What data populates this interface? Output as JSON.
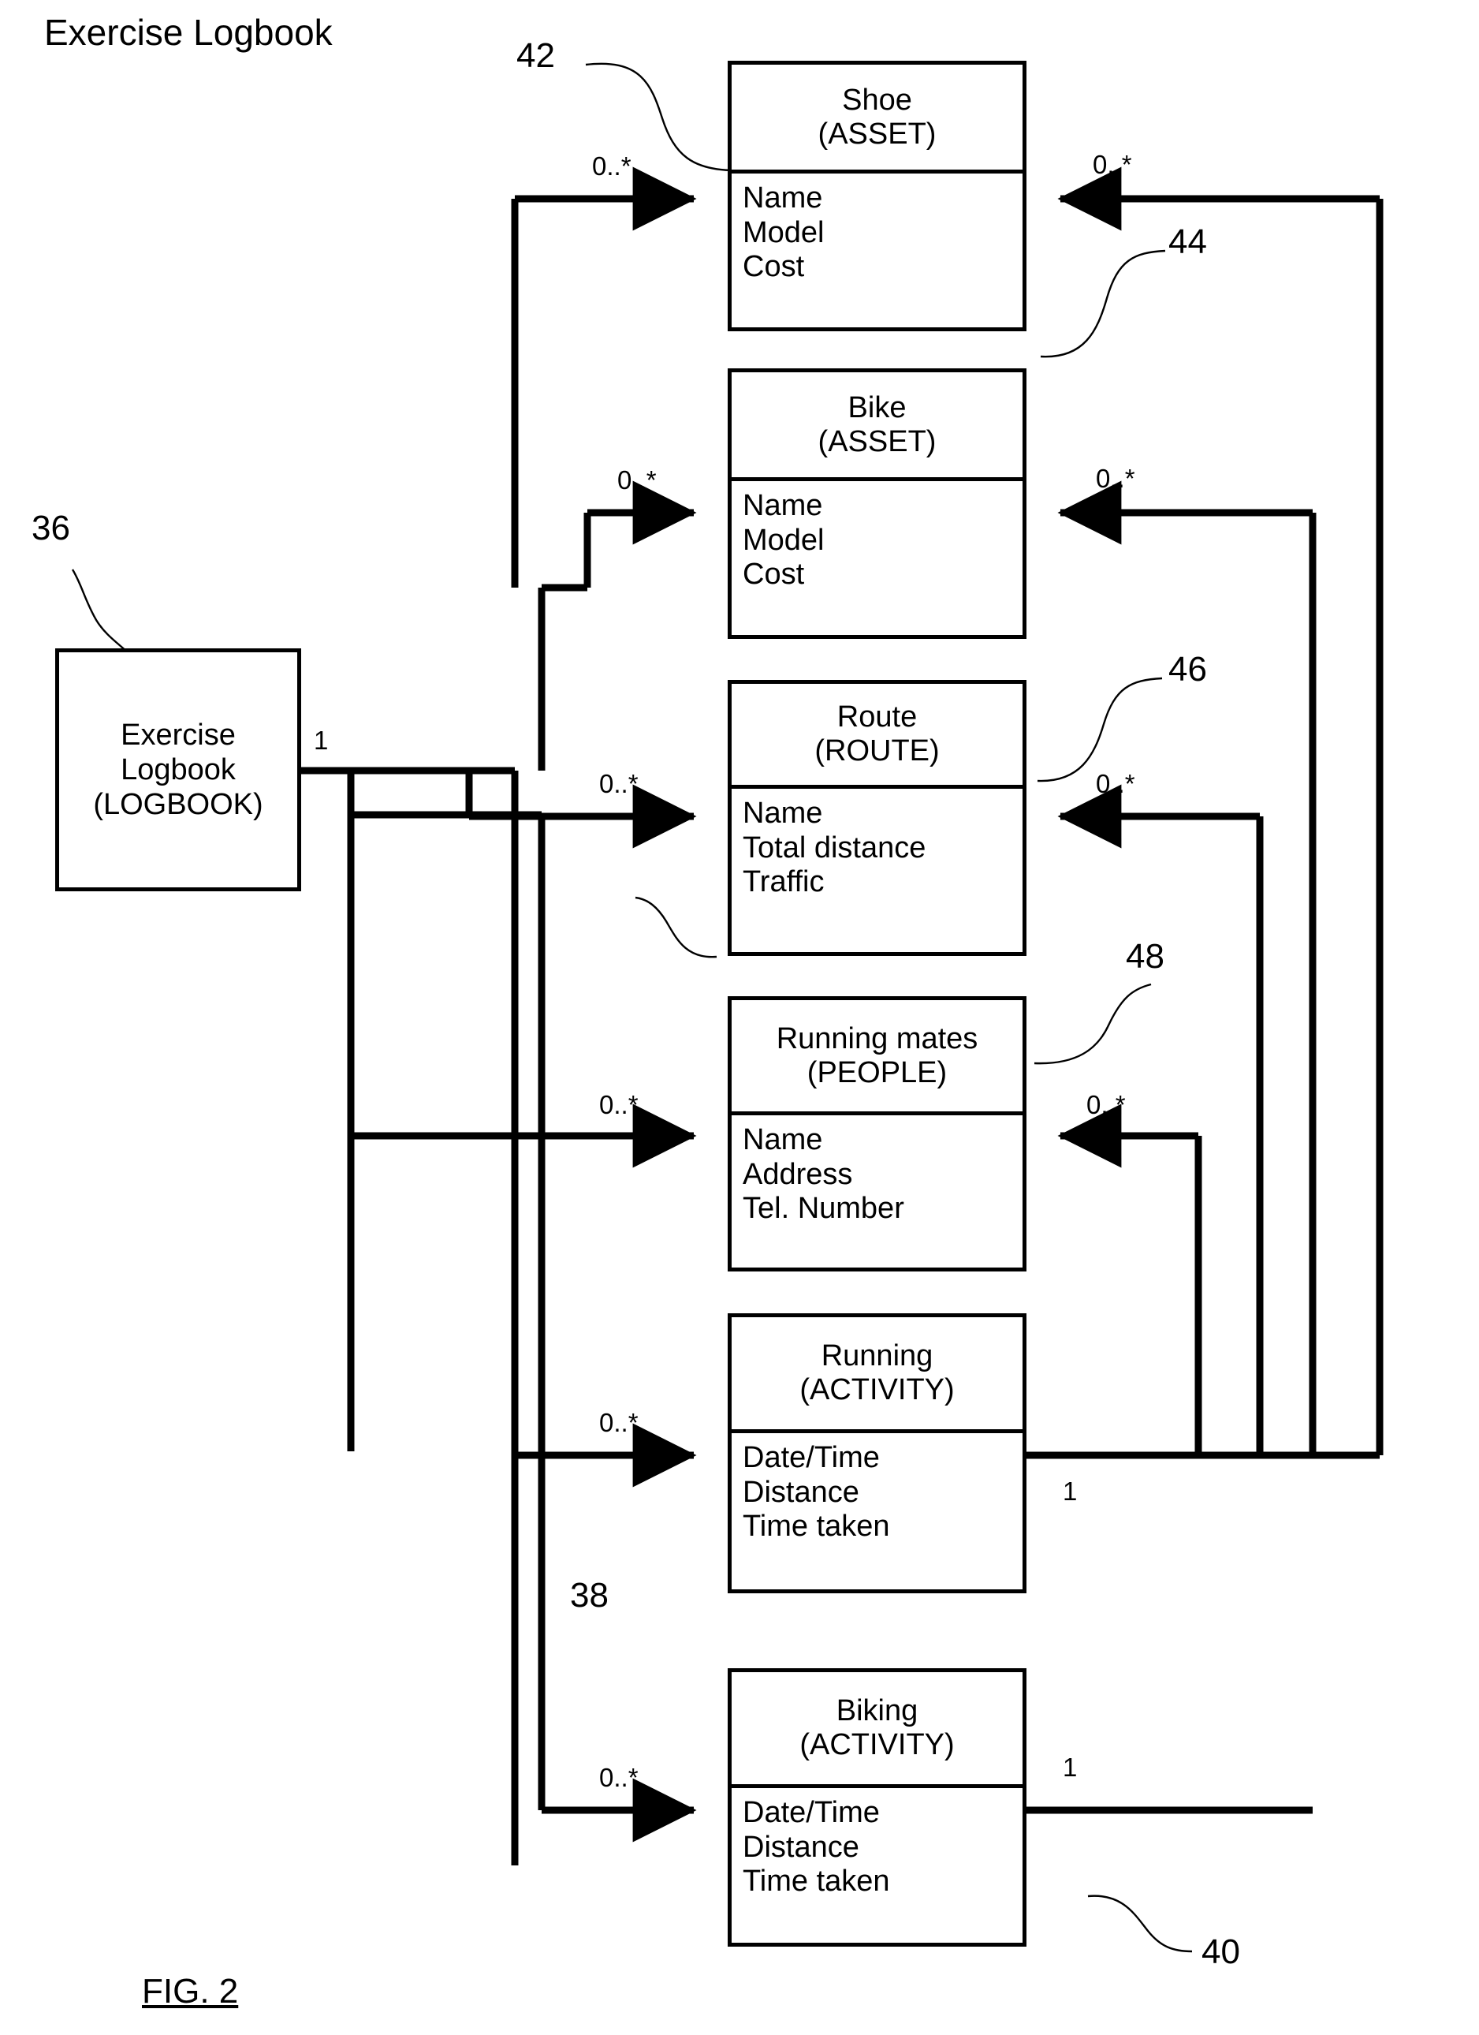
{
  "page": {
    "title": "Exercise Logbook",
    "figure_label": "FIG. 2",
    "line_color": "#000000",
    "background": "#ffffff"
  },
  "root_entity": {
    "ref": "36",
    "name_line1": "Exercise",
    "name_line2": "Logbook",
    "type_line": "(LOGBOOK)",
    "out_multiplicity": "1"
  },
  "entities": [
    {
      "ref": "42",
      "title": "Shoe",
      "stereotype": "(ASSET)",
      "attributes": [
        "Name",
        "Model",
        "Cost"
      ],
      "in_multiplicity": "0..*",
      "back_multiplicity": "0..*"
    },
    {
      "ref": "44",
      "title": "Bike",
      "stereotype": "(ASSET)",
      "attributes": [
        "Name",
        "Model",
        "Cost"
      ],
      "in_multiplicity": "0..*",
      "back_multiplicity": "0..*"
    },
    {
      "ref": "46",
      "title": "Route",
      "stereotype": "(ROUTE)",
      "attributes": [
        "Name",
        "Total distance",
        "Traffic"
      ],
      "in_multiplicity": "0..*",
      "back_multiplicity": "0..*"
    },
    {
      "ref": "48",
      "title": "Running mates",
      "stereotype": "(PEOPLE)",
      "attributes": [
        "Name",
        "Address",
        "Tel. Number"
      ],
      "in_multiplicity": "0..*",
      "back_multiplicity": "0..*"
    },
    {
      "ref": "38",
      "title": "Running",
      "stereotype": "(ACTIVITY)",
      "attributes": [
        "Date/Time",
        "Distance",
        "Time taken"
      ],
      "in_multiplicity": "0..*",
      "out_multiplicity": "1"
    },
    {
      "ref": "40",
      "title": "Biking",
      "stereotype": "(ACTIVITY)",
      "attributes": [
        "Date/Time",
        "Distance",
        "Time taken"
      ],
      "in_multiplicity": "0..*",
      "out_multiplicity": "1"
    }
  ]
}
